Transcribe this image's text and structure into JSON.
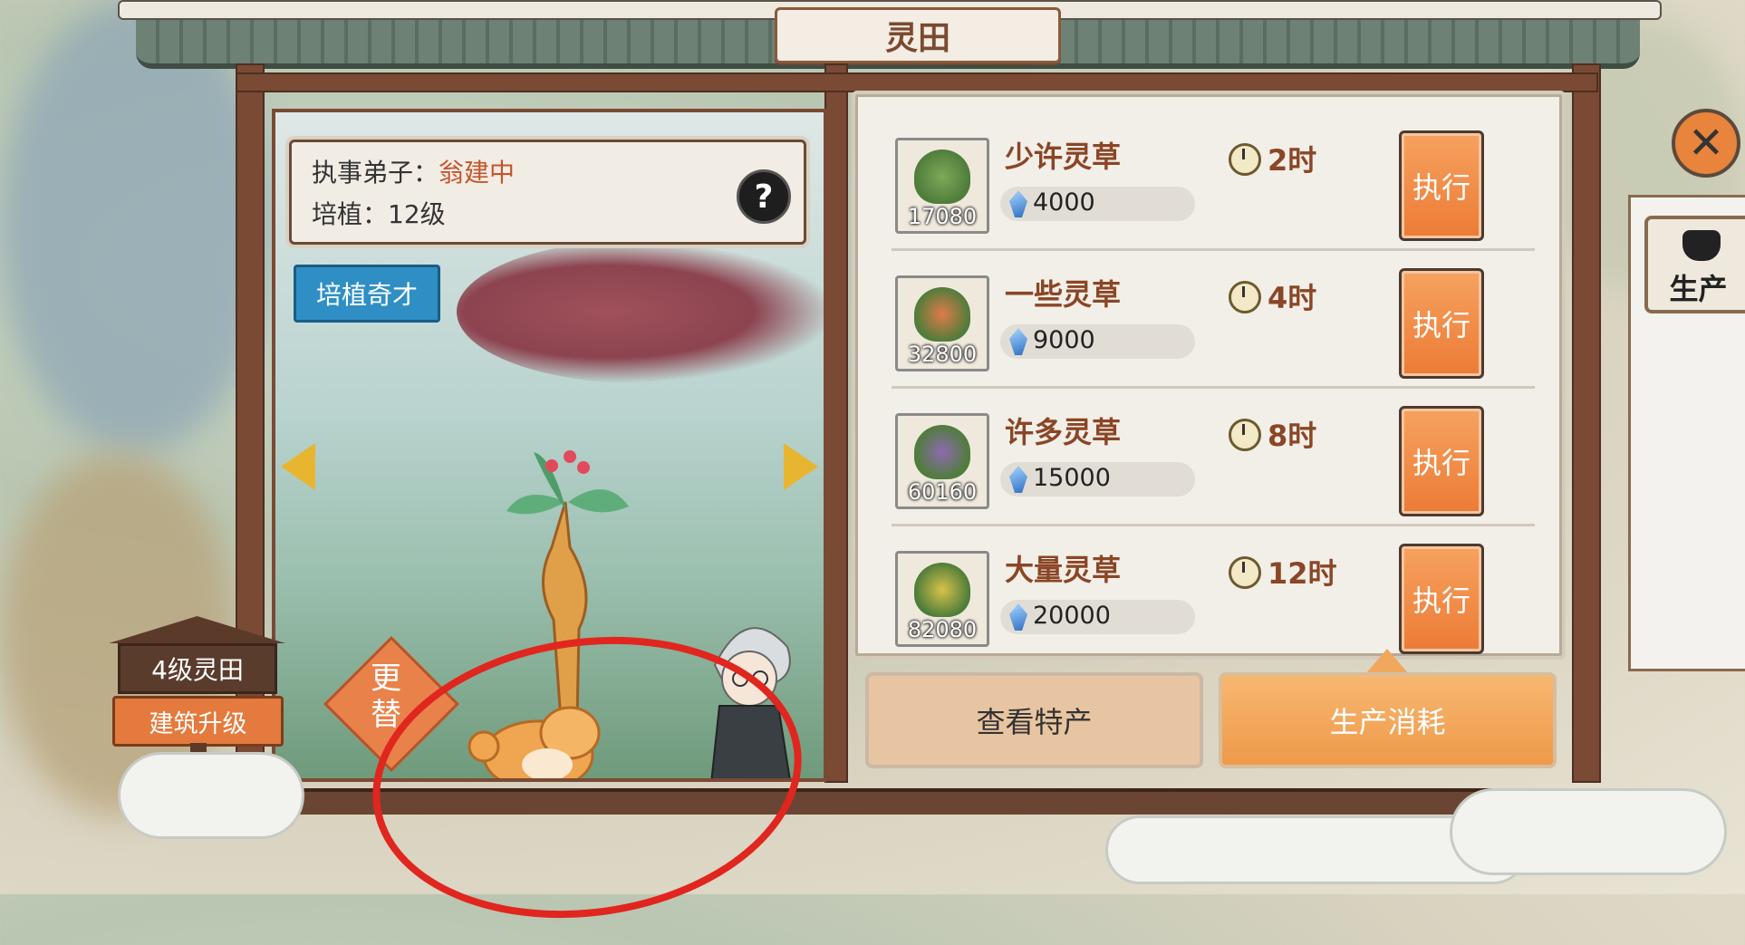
{
  "title": "灵田",
  "info": {
    "disciple_label": "执事弟子：",
    "disciple_name": "翁建中",
    "cultivate_label": "培植：",
    "cultivate_level": "12级"
  },
  "help_label": "?",
  "talent_button": "培植奇才",
  "replace_button": "更替",
  "field_level": "4级灵田",
  "upgrade_button": "建筑升级",
  "production_rows": [
    {
      "name": "少许灵草",
      "count": "17080",
      "cost": "4000",
      "time": "2时",
      "action": "执行"
    },
    {
      "name": "一些灵草",
      "count": "32800",
      "cost": "9000",
      "time": "4时",
      "action": "执行"
    },
    {
      "name": "许多灵草",
      "count": "60160",
      "cost": "15000",
      "time": "8时",
      "action": "执行"
    },
    {
      "name": "大量灵草",
      "count": "82080",
      "cost": "20000",
      "time": "12时",
      "action": "执行"
    }
  ],
  "view_specialty_button": "查看特产",
  "production_consume_button": "生产消耗",
  "side_tab_label": "生产",
  "close_label": "✕",
  "colors": {
    "accent_orange": "#ec7b36",
    "name_brown": "#8a4626",
    "talent_blue": "#2f8fc4",
    "annotation_red": "#e0261e"
  }
}
